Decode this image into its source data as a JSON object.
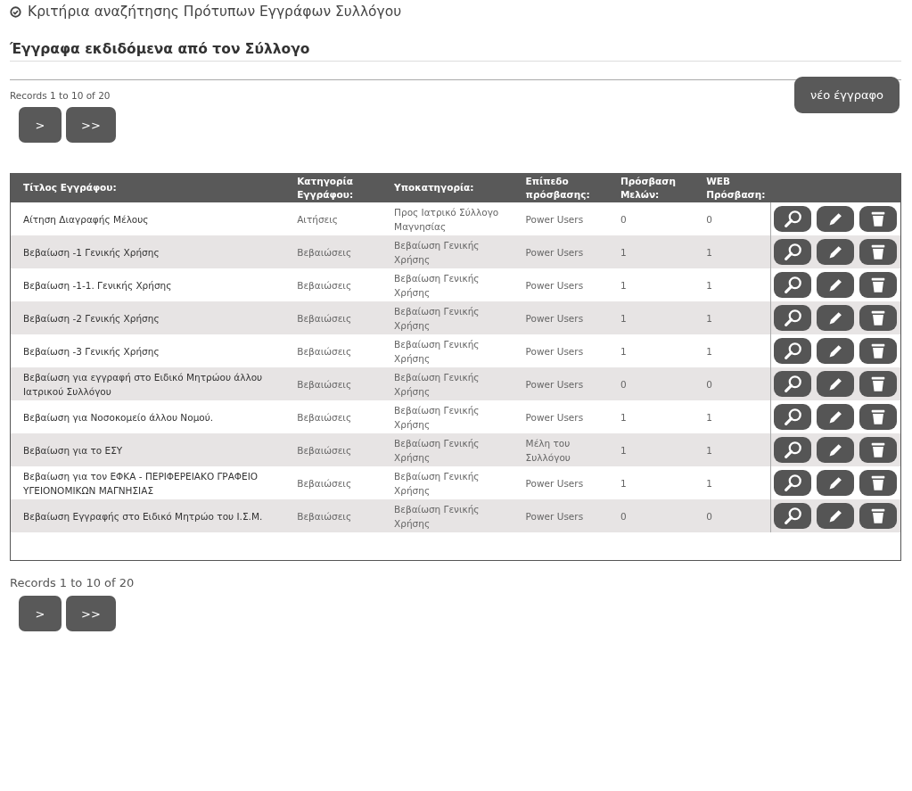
{
  "search_criteria": {
    "label": "Κριτήρια αναζήτησης Πρότυπων Εγγράφων Συλλόγου"
  },
  "section_title": "Έγγραφα εκδιδόμενα από τον Σύλλογο",
  "pager_top": {
    "summary": "Records 1 to 10 of 20",
    "buttons": [
      ">",
      ">>"
    ]
  },
  "new_button": "νέο έγγραφο",
  "table": {
    "columns": [
      "Τίτλος Εγγράφου:",
      "Κατηγορία Εγγράφου:",
      "Υποκατηγορία:",
      "Επίπεδο πρόσβασης:",
      "Πρόσβαση Μελών:",
      "WEB Πρόσβαση:"
    ],
    "rows": [
      {
        "title": "Αίτηση Διαγραφής Μέλους",
        "category": "Αιτήσεις",
        "subcategory": "Προς Ιατρικό Σύλλογο Μαγνησίας",
        "access_level": "Power Users",
        "member_access": "0",
        "web_access": "0"
      },
      {
        "title": "Βεβαίωση -1 Γενικής Χρήσης",
        "category": "Βεβαιώσεις",
        "subcategory": "Βεβαίωση Γενικής Χρήσης",
        "access_level": "Power Users",
        "member_access": "1",
        "web_access": "1"
      },
      {
        "title": "Βεβαίωση -1-1. Γενικής Χρήσης",
        "category": "Βεβαιώσεις",
        "subcategory": "Βεβαίωση Γενικής Χρήσης",
        "access_level": "Power Users",
        "member_access": "1",
        "web_access": "1"
      },
      {
        "title": "Βεβαίωση -2 Γενικής Χρήσης",
        "category": "Βεβαιώσεις",
        "subcategory": "Βεβαίωση Γενικής Χρήσης",
        "access_level": "Power Users",
        "member_access": "1",
        "web_access": "1"
      },
      {
        "title": "Βεβαίωση -3 Γενικής Χρήσης",
        "category": "Βεβαιώσεις",
        "subcategory": "Βεβαίωση Γενικής Χρήσης",
        "access_level": "Power Users",
        "member_access": "1",
        "web_access": "1"
      },
      {
        "title": "Βεβαίωση για εγγραφή στο Ειδικό Μητρώου άλλου Ιατρικού Συλλόγου",
        "category": "Βεβαιώσεις",
        "subcategory": "Βεβαίωση Γενικής Χρήσης",
        "access_level": "Power Users",
        "member_access": "0",
        "web_access": "0"
      },
      {
        "title": "Βεβαίωση για Νοσοκομείο άλλου Νομού.",
        "category": "Βεβαιώσεις",
        "subcategory": "Βεβαίωση Γενικής Χρήσης",
        "access_level": "Power Users",
        "member_access": "1",
        "web_access": "1"
      },
      {
        "title": "Βεβαίωση για το ΕΣΥ",
        "category": "Βεβαιώσεις",
        "subcategory": "Βεβαίωση Γενικής Χρήσης",
        "access_level": "Μέλη του Συλλόγου",
        "member_access": "1",
        "web_access": "1"
      },
      {
        "title": "Βεβαίωση για τον ΕΦΚΑ - ΠΕΡΙΦΕΡΕΙΑΚΟ ΓΡΑΦΕΙΟ ΥΓΕΙΟΝΟΜΙΚΩΝ ΜΑΓΝΗΣΙΑΣ",
        "category": "Βεβαιώσεις",
        "subcategory": "Βεβαίωση Γενικής Χρήσης",
        "access_level": "Power Users",
        "member_access": "1",
        "web_access": "1"
      },
      {
        "title": "Βεβαίωση Εγγραφής στο Ειδικό Μητρώο του Ι.Σ.Μ.",
        "category": "Βεβαιώσεις",
        "subcategory": "Βεβαίωση Γενικής Χρήσης",
        "access_level": "Power Users",
        "member_access": "0",
        "web_access": "0"
      }
    ]
  },
  "pager_bottom": {
    "summary": "Records 1 to 10 of 20",
    "buttons": [
      ">",
      ">>"
    ]
  }
}
